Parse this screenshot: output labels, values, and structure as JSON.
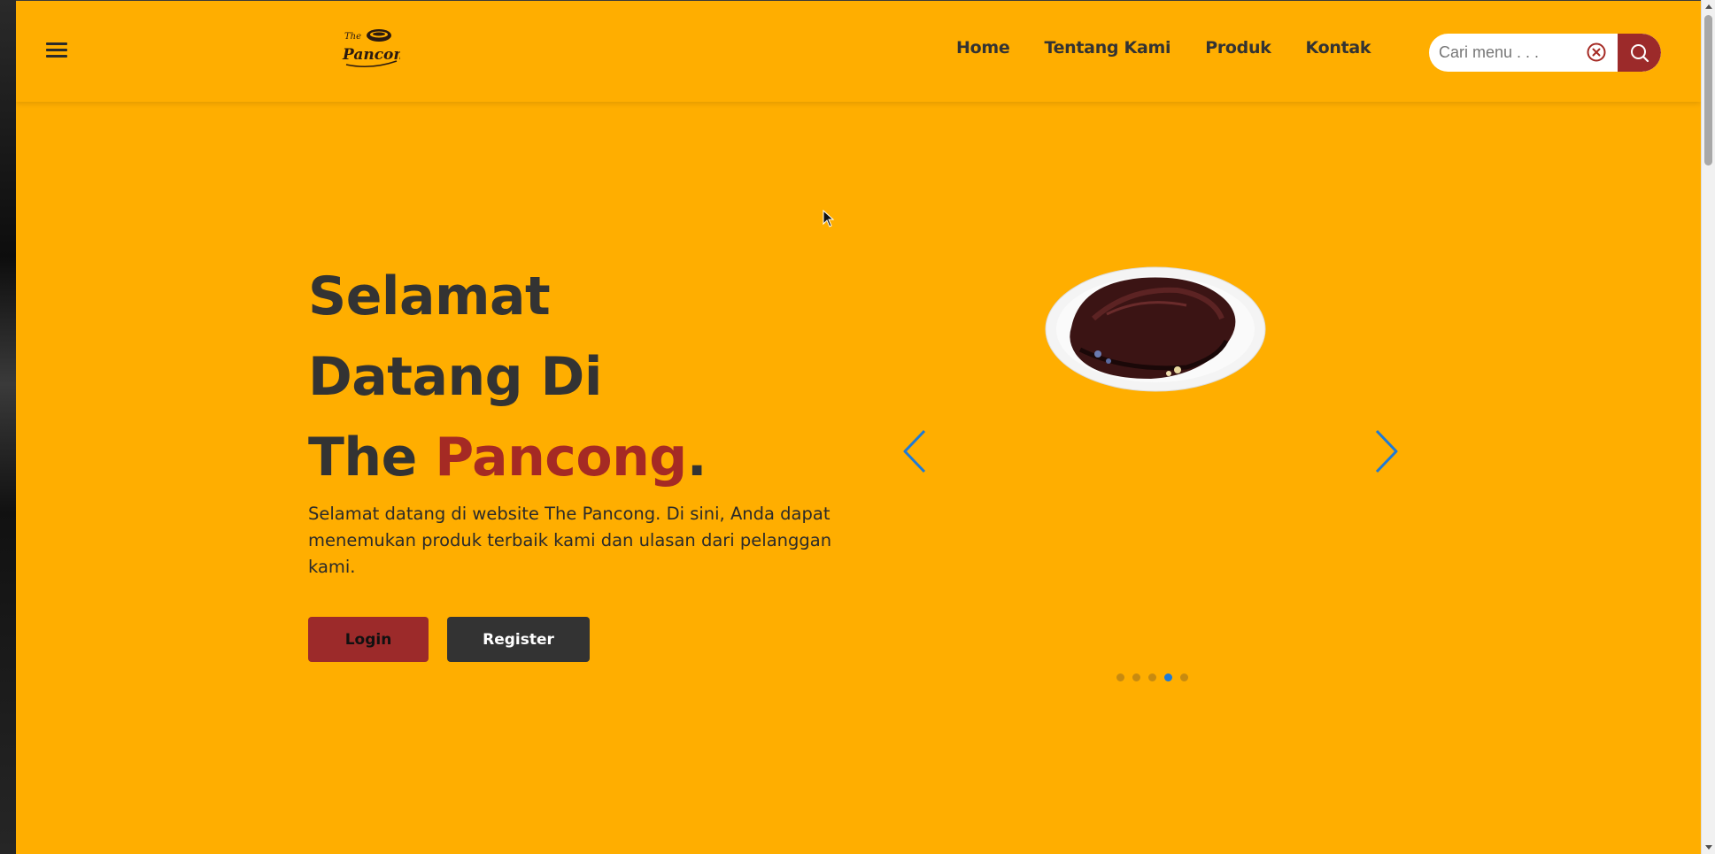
{
  "brand": {
    "logo_line1": "The",
    "logo_line2": "Pancong"
  },
  "nav": {
    "items": [
      "Home",
      "Tentang Kami",
      "Produk",
      "Kontak"
    ]
  },
  "search": {
    "placeholder": "Cari menu . . .",
    "value": ""
  },
  "hero": {
    "title_line1": "Selamat",
    "title_line2": "Datang Di",
    "title_line3_prefix": "The ",
    "title_line3_accent": "Pancong",
    "title_line3_suffix": ".",
    "description": "Selamat datang di website The Pancong. Di sini, Anda dapat menemukan produk terbaik kami dan ulasan dari pelanggan kami.",
    "login_label": "Login",
    "register_label": "Register"
  },
  "carousel": {
    "slide_count": 5,
    "active_index": 3
  },
  "colors": {
    "page_background": "#ffae00",
    "accent": "#a52a24",
    "login_button": "#9c2a2a",
    "register_button": "#333333",
    "carousel_arrow": "#1f7ad6",
    "active_dot": "#1f7ad6"
  },
  "icons": {
    "menu": "hamburger-icon",
    "clear": "x-circle-icon",
    "search": "magnifier-icon",
    "prev": "chevron-left-icon",
    "next": "chevron-right-icon"
  }
}
